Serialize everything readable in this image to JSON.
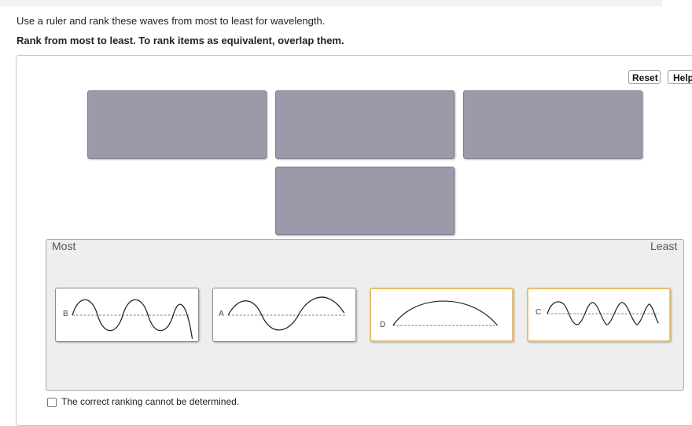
{
  "instructions": {
    "line1": "Use a ruler and rank these waves from most to least for wavelength.",
    "line2": "Rank from most to least. To rank items as equivalent, overlap them."
  },
  "toolbar": {
    "reset_label": "Reset",
    "help_label": "Help"
  },
  "ranking": {
    "most_label": "Most",
    "least_label": "Least"
  },
  "cards": [
    {
      "letter": "B",
      "icon": "wave-b-icon"
    },
    {
      "letter": "A",
      "icon": "wave-a-icon"
    },
    {
      "letter": "D",
      "icon": "wave-d-icon"
    },
    {
      "letter": "C",
      "icon": "wave-c-icon"
    }
  ],
  "checkbox": {
    "label": "The correct ranking cannot be determined."
  },
  "colors": {
    "slot_fill": "#9b99aa",
    "selected_border": "#e8c070"
  }
}
